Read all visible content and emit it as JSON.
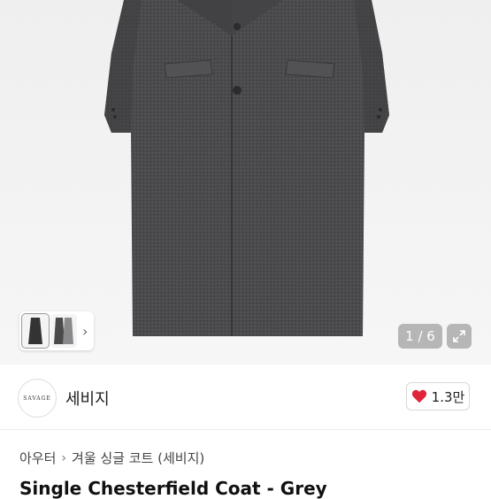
{
  "gallery": {
    "counter": "1 / 6",
    "thumbnail_next": "›"
  },
  "seller": {
    "logo_text": "SAVAGE",
    "name": "세비지",
    "likes": "1.3만"
  },
  "breadcrumb": {
    "items": [
      "아우터",
      "겨울 싱글 코트 (세비지)"
    ],
    "separator": "›"
  },
  "product": {
    "title": "Single Chesterfield Coat - Grey"
  },
  "colors": {
    "heart": "#e0243a",
    "coat": "#4a4a4c"
  },
  "icons": [
    "expand-icon",
    "heart-icon",
    "chevron-right-icon"
  ]
}
